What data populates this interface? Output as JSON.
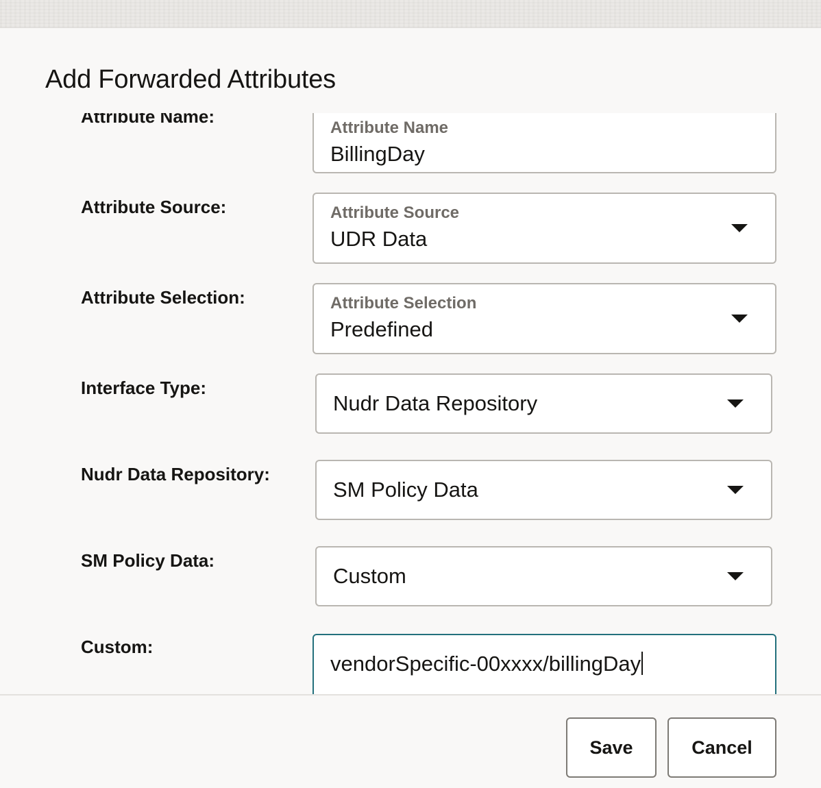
{
  "dialog": {
    "title": "Add Forwarded Attributes"
  },
  "form": {
    "attribute_name": {
      "row_label": "Attribute Name:",
      "field_label": "Attribute Name",
      "value": "BillingDay"
    },
    "attribute_source": {
      "row_label": "Attribute Source:",
      "field_label": "Attribute Source",
      "value": "UDR Data"
    },
    "attribute_selection": {
      "row_label": "Attribute Selection:",
      "field_label": "Attribute Selection",
      "value": "Predefined"
    },
    "interface_type": {
      "row_label": "Interface Type:",
      "value": "Nudr Data Repository"
    },
    "nudr_data_repository": {
      "row_label": "Nudr Data Repository:",
      "value": "SM Policy Data"
    },
    "sm_policy_data": {
      "row_label": "SM Policy Data:",
      "value": "Custom"
    },
    "custom": {
      "row_label": "Custom:",
      "value": "vendorSpecific-00xxxx/billingDay"
    }
  },
  "footer": {
    "save_label": "Save",
    "cancel_label": "Cancel"
  },
  "colors": {
    "focus_border": "#23707c",
    "field_border": "#b9b6b1",
    "dialog_background": "#f9f8f7"
  },
  "icons": {
    "dropdown": "caret-down-icon"
  }
}
